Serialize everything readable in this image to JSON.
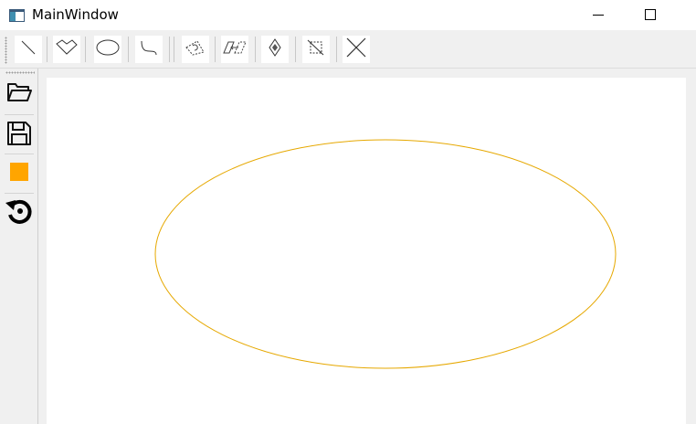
{
  "window": {
    "title": "MainWindow",
    "icon": "app-window-icon"
  },
  "window_controls": {
    "minimize_icon": "minimize-icon",
    "maximize_icon": "maximize-icon"
  },
  "top_toolbar": {
    "tools": [
      {
        "name": "line",
        "icon": "line-icon"
      },
      {
        "name": "polygon",
        "icon": "polygon-icon"
      },
      {
        "name": "ellipse",
        "icon": "ellipse-icon"
      },
      {
        "name": "curve",
        "icon": "curve-icon"
      },
      {
        "name": "rotate",
        "icon": "rotate-shape-icon"
      },
      {
        "name": "translate",
        "icon": "translate-shape-icon"
      },
      {
        "name": "scale",
        "icon": "scale-shape-icon"
      },
      {
        "name": "clip",
        "icon": "clip-icon"
      },
      {
        "name": "delete",
        "icon": "delete-x-icon"
      }
    ]
  },
  "left_toolbar": {
    "tools": [
      {
        "name": "open",
        "icon": "folder-open-icon"
      },
      {
        "name": "save",
        "icon": "save-icon"
      },
      {
        "name": "color",
        "icon": "color-swatch-icon",
        "color": "#FFA500"
      },
      {
        "name": "reset",
        "icon": "reset-icon"
      }
    ]
  },
  "canvas": {
    "shapes": [
      {
        "type": "ellipse",
        "stroke": "#E6A800"
      }
    ]
  }
}
